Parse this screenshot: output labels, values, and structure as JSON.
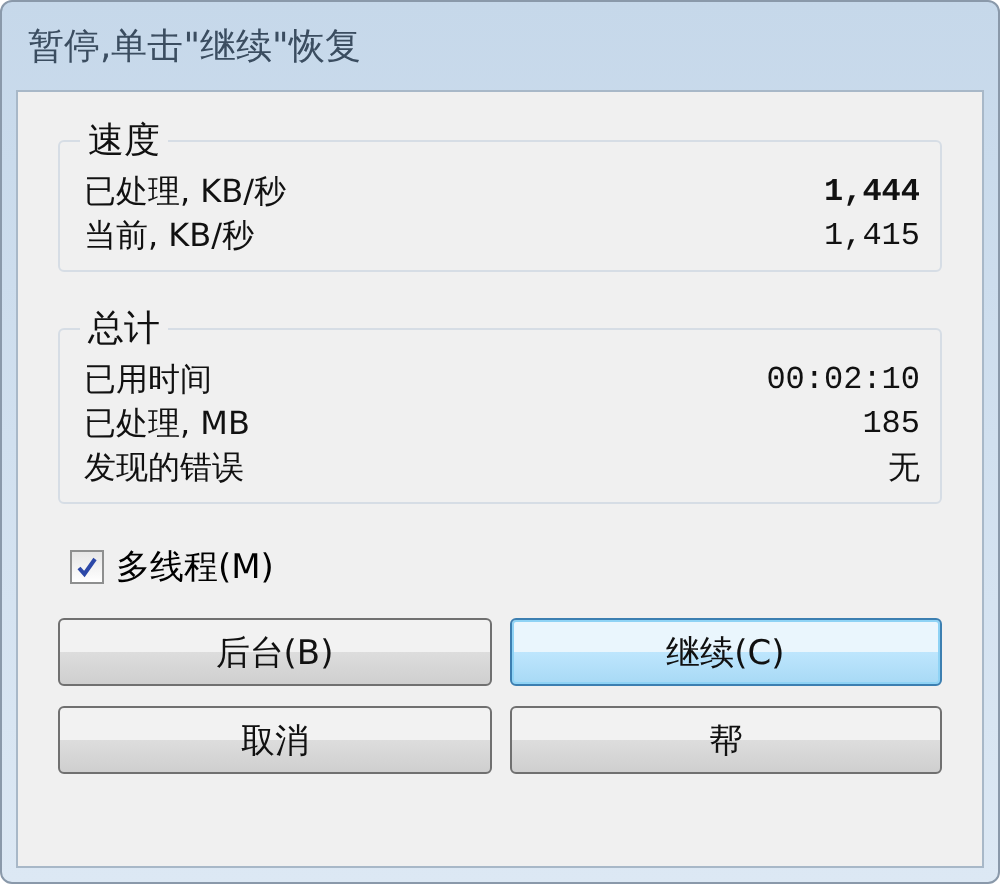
{
  "window": {
    "title": "暂停,单击\"继续\"恢复"
  },
  "groups": [
    {
      "title": "速度",
      "rows": [
        {
          "label": "已处理, KB/秒",
          "value": "1,444",
          "bold": true
        },
        {
          "label": "当前, KB/秒",
          "value": "1,415",
          "bold": false
        }
      ]
    },
    {
      "title": "总计",
      "rows": [
        {
          "label": "已用时间",
          "value": "00:02:10",
          "bold": false
        },
        {
          "label": "已处理, MB",
          "value": "185",
          "bold": false
        },
        {
          "label": "发现的错误",
          "value": "无",
          "bold": false
        }
      ]
    }
  ],
  "checkbox": {
    "label": "多线程(M)",
    "checked": true
  },
  "buttons": [
    {
      "label": "后台(B)",
      "focused": false
    },
    {
      "label": "继续(C)",
      "focused": true
    },
    {
      "label": "取消",
      "focused": false
    },
    {
      "label": "帮",
      "focused": false
    }
  ]
}
